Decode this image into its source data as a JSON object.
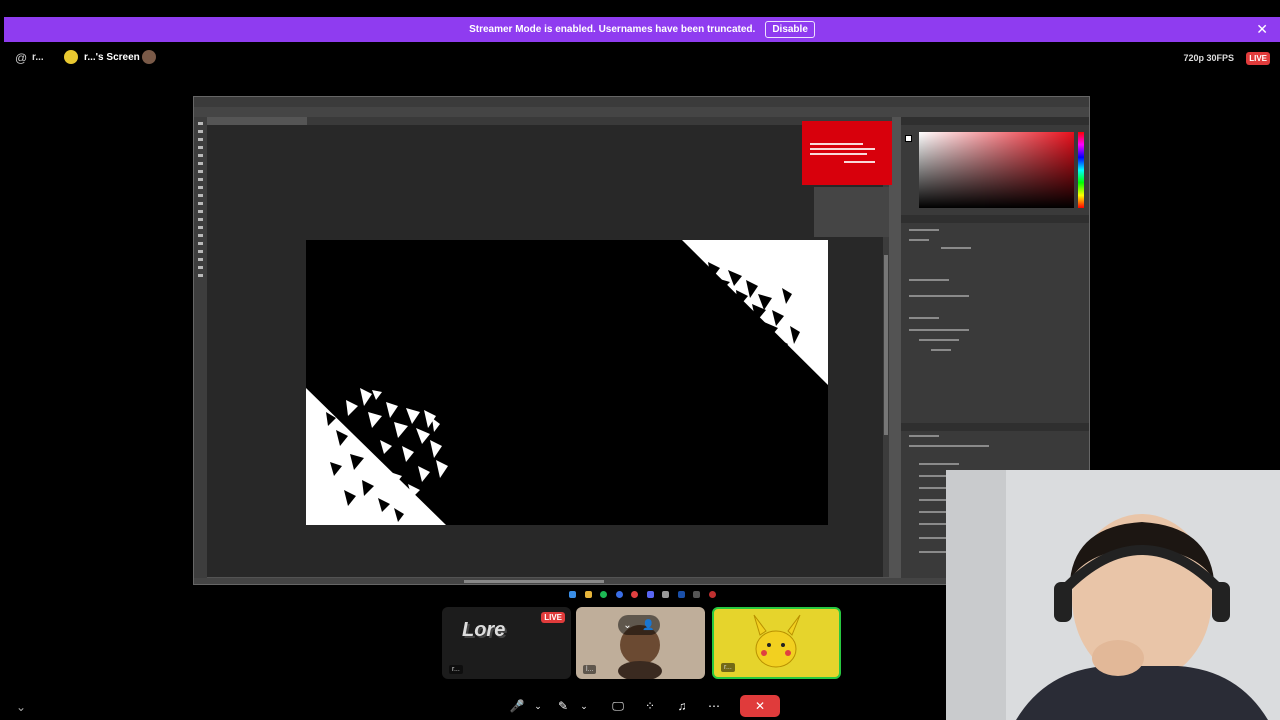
{
  "banner": {
    "message": "Streamer Mode is enabled. Usernames have been truncated.",
    "disable_label": "Disable",
    "close_icon": "✕"
  },
  "topbar": {
    "at_icon": "@",
    "user": "r...",
    "screen_title": "r...'s Screen",
    "quality": "720p 30FPS",
    "live": "LIVE"
  },
  "tiles": [
    {
      "label": "Lore",
      "live": "LIVE",
      "badge": "r..."
    },
    {
      "badge": "l..."
    },
    {
      "badge": "r..."
    }
  ],
  "tile_ctrl": {
    "chevron": "⌄",
    "user_icon": "👤"
  },
  "controls": {
    "mic": "🎤",
    "mic_menu": "⌄",
    "video": "✎",
    "video_menu": "⌄",
    "screen": "🖵",
    "activities": "⁘",
    "effects": "♫",
    "more": "⋯",
    "end": "✕"
  },
  "corner_chevron": "⌄",
  "colors": {
    "banner": "#8f3cf0",
    "live": "#e03b3b",
    "speaking": "#28c840",
    "ps_alert": "#d8000c"
  }
}
